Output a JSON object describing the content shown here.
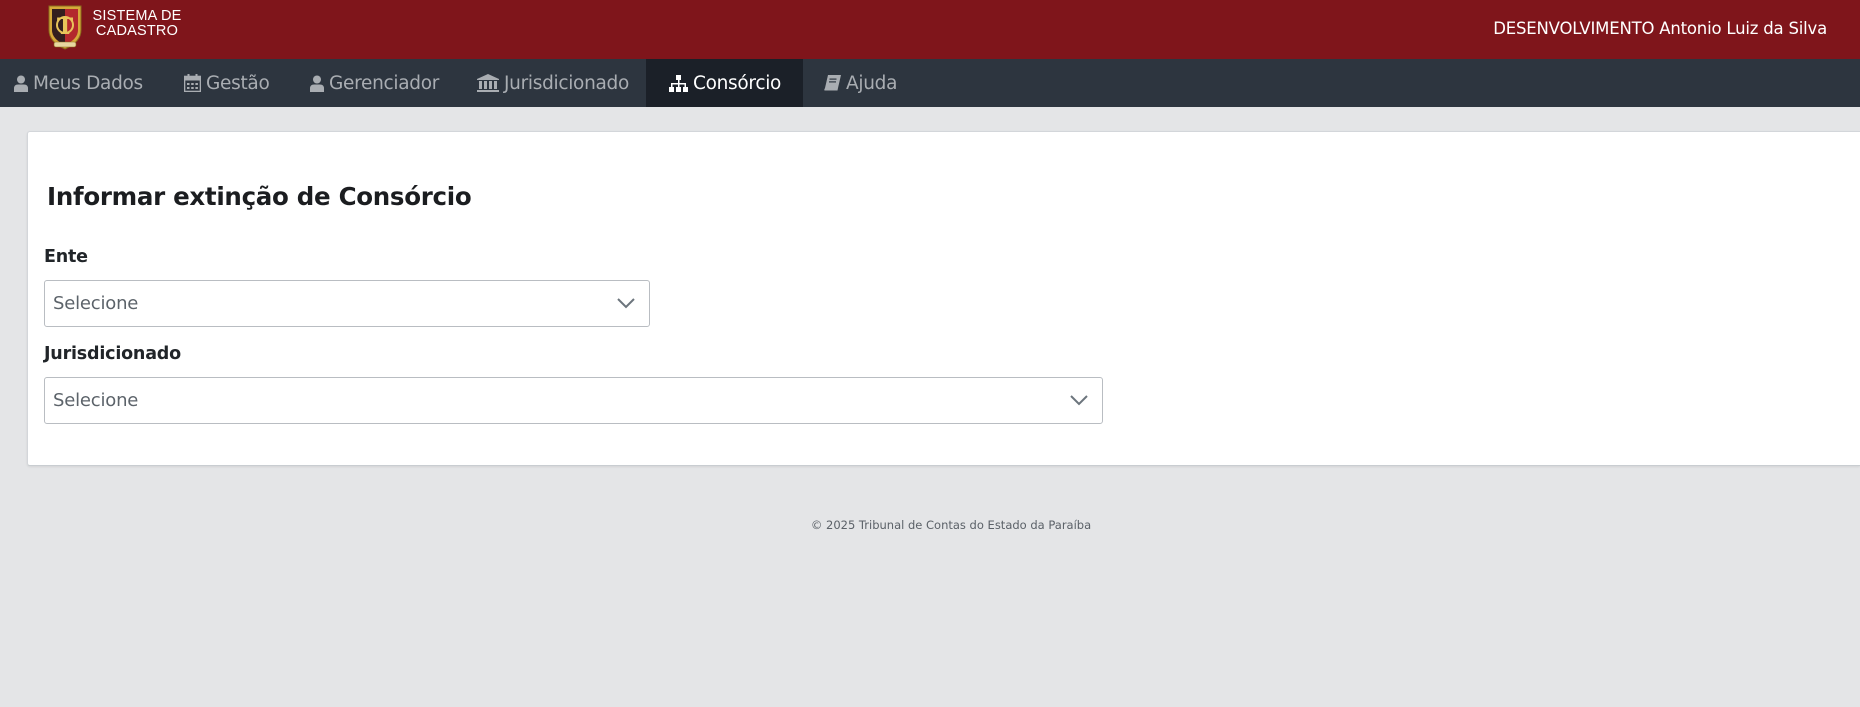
{
  "header": {
    "logo_line1": "SISTEMA DE",
    "logo_line2": "CADASTRO",
    "user_text": "DESENVOLVIMENTO Antonio Luiz da Silva",
    "brand_color": "#7f151b"
  },
  "nav": {
    "items": [
      {
        "label": "Meus Dados",
        "icon": "user-icon"
      },
      {
        "label": "Gestão",
        "icon": "calendar-icon"
      },
      {
        "label": "Gerenciador",
        "icon": "user-icon"
      },
      {
        "label": "Jurisdicionado",
        "icon": "bank-icon"
      },
      {
        "label": "Consórcio",
        "icon": "sitemap-icon",
        "active": true
      },
      {
        "label": "Ajuda",
        "icon": "book-icon"
      }
    ]
  },
  "form": {
    "title": "Informar extinção de Consórcio",
    "ente_label": "Ente",
    "ente_value": "Selecione",
    "jurisdicionado_label": "Jurisdicionado",
    "jurisdicionado_value": "Selecione"
  },
  "footer": {
    "text": "© 2025 Tribunal de Contas do Estado da Paraíba"
  }
}
